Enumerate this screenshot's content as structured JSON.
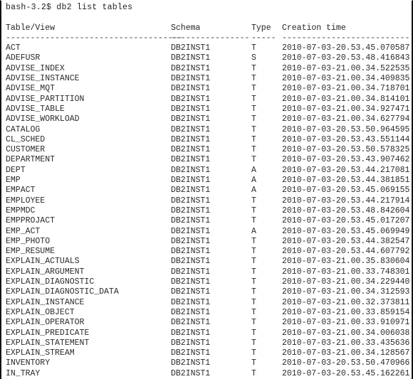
{
  "terminal": {
    "prompt": "bash-3.2$ ",
    "command": "db2 list tables",
    "prompt_line": "bash-3.2$ db2 list tables",
    "blank_line": ""
  },
  "table": {
    "headers": {
      "name": "Table/View",
      "schema": "Schema",
      "type": "Type",
      "time": "Creation time"
    },
    "separators": {
      "name": "------------------------------------",
      "schema": "----------------",
      "type": "-----",
      "time": "--------------------------"
    },
    "rows": [
      {
        "name": "ACT",
        "schema": "DB2INST1",
        "type": "T",
        "time": "2010-07-03-20.53.45.070587"
      },
      {
        "name": "ADEFUSR",
        "schema": "DB2INST1",
        "type": "S",
        "time": "2010-07-03-20.53.48.416843"
      },
      {
        "name": "ADVISE_INDEX",
        "schema": "DB2INST1",
        "type": "T",
        "time": "2010-07-03-21.00.34.522535"
      },
      {
        "name": "ADVISE_INSTANCE",
        "schema": "DB2INST1",
        "type": "T",
        "time": "2010-07-03-21.00.34.409835"
      },
      {
        "name": "ADVISE_MQT",
        "schema": "DB2INST1",
        "type": "T",
        "time": "2010-07-03-21.00.34.718701"
      },
      {
        "name": "ADVISE_PARTITION",
        "schema": "DB2INST1",
        "type": "T",
        "time": "2010-07-03-21.00.34.814101"
      },
      {
        "name": "ADVISE_TABLE",
        "schema": "DB2INST1",
        "type": "T",
        "time": "2010-07-03-21.00.34.927471"
      },
      {
        "name": "ADVISE_WORKLOAD",
        "schema": "DB2INST1",
        "type": "T",
        "time": "2010-07-03-21.00.34.627794"
      },
      {
        "name": "CATALOG",
        "schema": "DB2INST1",
        "type": "T",
        "time": "2010-07-03-20.53.50.964595"
      },
      {
        "name": "CL_SCHED",
        "schema": "DB2INST1",
        "type": "T",
        "time": "2010-07-03-20.53.43.551144"
      },
      {
        "name": "CUSTOMER",
        "schema": "DB2INST1",
        "type": "T",
        "time": "2010-07-03-20.53.50.578325"
      },
      {
        "name": "DEPARTMENT",
        "schema": "DB2INST1",
        "type": "T",
        "time": "2010-07-03-20.53.43.907462"
      },
      {
        "name": "DEPT",
        "schema": "DB2INST1",
        "type": "A",
        "time": "2010-07-03-20.53.44.217081"
      },
      {
        "name": "EMP",
        "schema": "DB2INST1",
        "type": "A",
        "time": "2010-07-03-20.53.44.381851"
      },
      {
        "name": "EMPACT",
        "schema": "DB2INST1",
        "type": "A",
        "time": "2010-07-03-20.53.45.069155"
      },
      {
        "name": "EMPLOYEE",
        "schema": "DB2INST1",
        "type": "T",
        "time": "2010-07-03-20.53.44.217914"
      },
      {
        "name": "EMPMDC",
        "schema": "DB2INST1",
        "type": "T",
        "time": "2010-07-03-20.53.48.842604"
      },
      {
        "name": "EMPPROJACT",
        "schema": "DB2INST1",
        "type": "T",
        "time": "2010-07-03-20.53.45.017207"
      },
      {
        "name": "EMP_ACT",
        "schema": "DB2INST1",
        "type": "A",
        "time": "2010-07-03-20.53.45.069949"
      },
      {
        "name": "EMP_PHOTO",
        "schema": "DB2INST1",
        "type": "T",
        "time": "2010-07-03-20.53.44.382547"
      },
      {
        "name": "EMP_RESUME",
        "schema": "DB2INST1",
        "type": "T",
        "time": "2010-07-03-20.53.44.607792"
      },
      {
        "name": "EXPLAIN_ACTUALS",
        "schema": "DB2INST1",
        "type": "T",
        "time": "2010-07-03-21.00.35.830604"
      },
      {
        "name": "EXPLAIN_ARGUMENT",
        "schema": "DB2INST1",
        "type": "T",
        "time": "2010-07-03-21.00.33.748301"
      },
      {
        "name": "EXPLAIN_DIAGNOSTIC",
        "schema": "DB2INST1",
        "type": "T",
        "time": "2010-07-03-21.00.34.229440"
      },
      {
        "name": "EXPLAIN_DIAGNOSTIC_DATA",
        "schema": "DB2INST1",
        "type": "T",
        "time": "2010-07-03-21.00.34.312593"
      },
      {
        "name": "EXPLAIN_INSTANCE",
        "schema": "DB2INST1",
        "type": "T",
        "time": "2010-07-03-21.00.32.373811"
      },
      {
        "name": "EXPLAIN_OBJECT",
        "schema": "DB2INST1",
        "type": "T",
        "time": "2010-07-03-21.00.33.859154"
      },
      {
        "name": "EXPLAIN_OPERATOR",
        "schema": "DB2INST1",
        "type": "T",
        "time": "2010-07-03-21.00.33.910971"
      },
      {
        "name": "EXPLAIN_PREDICATE",
        "schema": "DB2INST1",
        "type": "T",
        "time": "2010-07-03-21.00.34.006038"
      },
      {
        "name": "EXPLAIN_STATEMENT",
        "schema": "DB2INST1",
        "type": "T",
        "time": "2010-07-03-21.00.33.435636"
      },
      {
        "name": "EXPLAIN_STREAM",
        "schema": "DB2INST1",
        "type": "T",
        "time": "2010-07-03-21.00.34.128567"
      },
      {
        "name": "INVENTORY",
        "schema": "DB2INST1",
        "type": "T",
        "time": "2010-07-03-20.53.50.470966"
      },
      {
        "name": "IN_TRAY",
        "schema": "DB2INST1",
        "type": "T",
        "time": "2010-07-03-20.53.45.162261"
      }
    ]
  },
  "colors": {
    "background": "#ffffff",
    "text": "#2b2b2b",
    "border": "#111111"
  }
}
